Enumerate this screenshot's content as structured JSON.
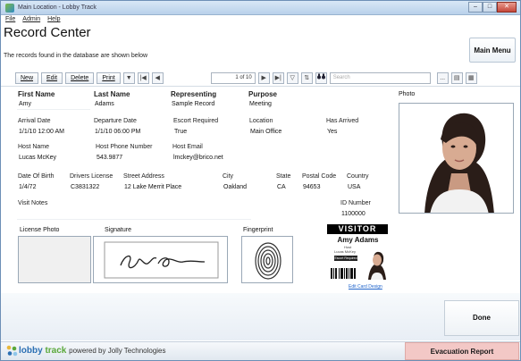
{
  "window": {
    "title": "Main Location - Lobby Track",
    "min": "–",
    "max": "□",
    "close": "✕"
  },
  "menu": [
    "File",
    "Admin",
    "Help"
  ],
  "header": {
    "title": "Record Center",
    "subtitle": "The records found in the database are shown below",
    "main_menu": "Main Menu"
  },
  "toolbar": {
    "new": "New",
    "edit": "Edit",
    "delete": "Delete",
    "print": "Print",
    "print_dropdown": "▼",
    "first": "|◀",
    "prev": "◀",
    "record_counter": "1 of 10",
    "next": "▶",
    "last": "▶|",
    "filter": "▽",
    "sort": "⇅",
    "search_placeholder": "Search",
    "search_button": "...",
    "view_list": "▤",
    "view_card": "▦"
  },
  "record": {
    "first_name_label": "First Name",
    "first_name": "Amy",
    "last_name_label": "Last Name",
    "last_name": "Adams",
    "representing_label": "Representing",
    "representing": "Sample Record",
    "purpose_label": "Purpose",
    "purpose": "Meeting",
    "arrival_label": "Arrival Date",
    "arrival": "1/1/10 12:00 AM",
    "departure_label": "Departure Date",
    "departure": "1/1/10 06:00 PM",
    "escort_label": "Escort Required",
    "escort": "True",
    "location_label": "Location",
    "location": "Main Office",
    "arrived_label": "Has Arrived",
    "arrived": "Yes",
    "host_label": "Host Name",
    "host": "Lucas McKey",
    "host_phone_label": "Host Phone Number",
    "host_phone": "543.9877",
    "host_email_label": "Host Email",
    "host_email": "lmckey@brico.net",
    "dob_label": "Date Of Birth",
    "dob": "1/4/72",
    "license_label": "Drivers License",
    "license": "C3831322",
    "street_label": "Street Address",
    "street": "12 Lake Merrit Place",
    "city_label": "City",
    "city": "Oakland",
    "state_label": "State",
    "state": "CA",
    "postal_label": "Postal Code",
    "postal": "94653",
    "country_label": "Country",
    "country": "USA",
    "notes_label": "Visit Notes",
    "notes": "",
    "id_label": "ID Number",
    "id": "1100000"
  },
  "media": {
    "photo_label": "Photo",
    "license_photo_label": "License Photo",
    "signature_label": "Signature",
    "fingerprint_label": "Fingerprint"
  },
  "badge": {
    "title": "VISITOR",
    "name": "Amy Adams",
    "host_small": "Host",
    "host_name": "Lucas McKey",
    "escort_tag": "Escort Required",
    "edit_link": "Edit Card Design"
  },
  "actions": {
    "done": "Done",
    "evacuation": "Evacuation Report"
  },
  "footer": {
    "lobby": "lobby",
    "track": "track",
    "powered": "powered by Jolly Technologies"
  },
  "colors": {
    "evac_bg": "#f3c8c6",
    "brand_blue": "#2b6fb3",
    "brand_green": "#5aa83a",
    "badge_header": "#000000"
  }
}
